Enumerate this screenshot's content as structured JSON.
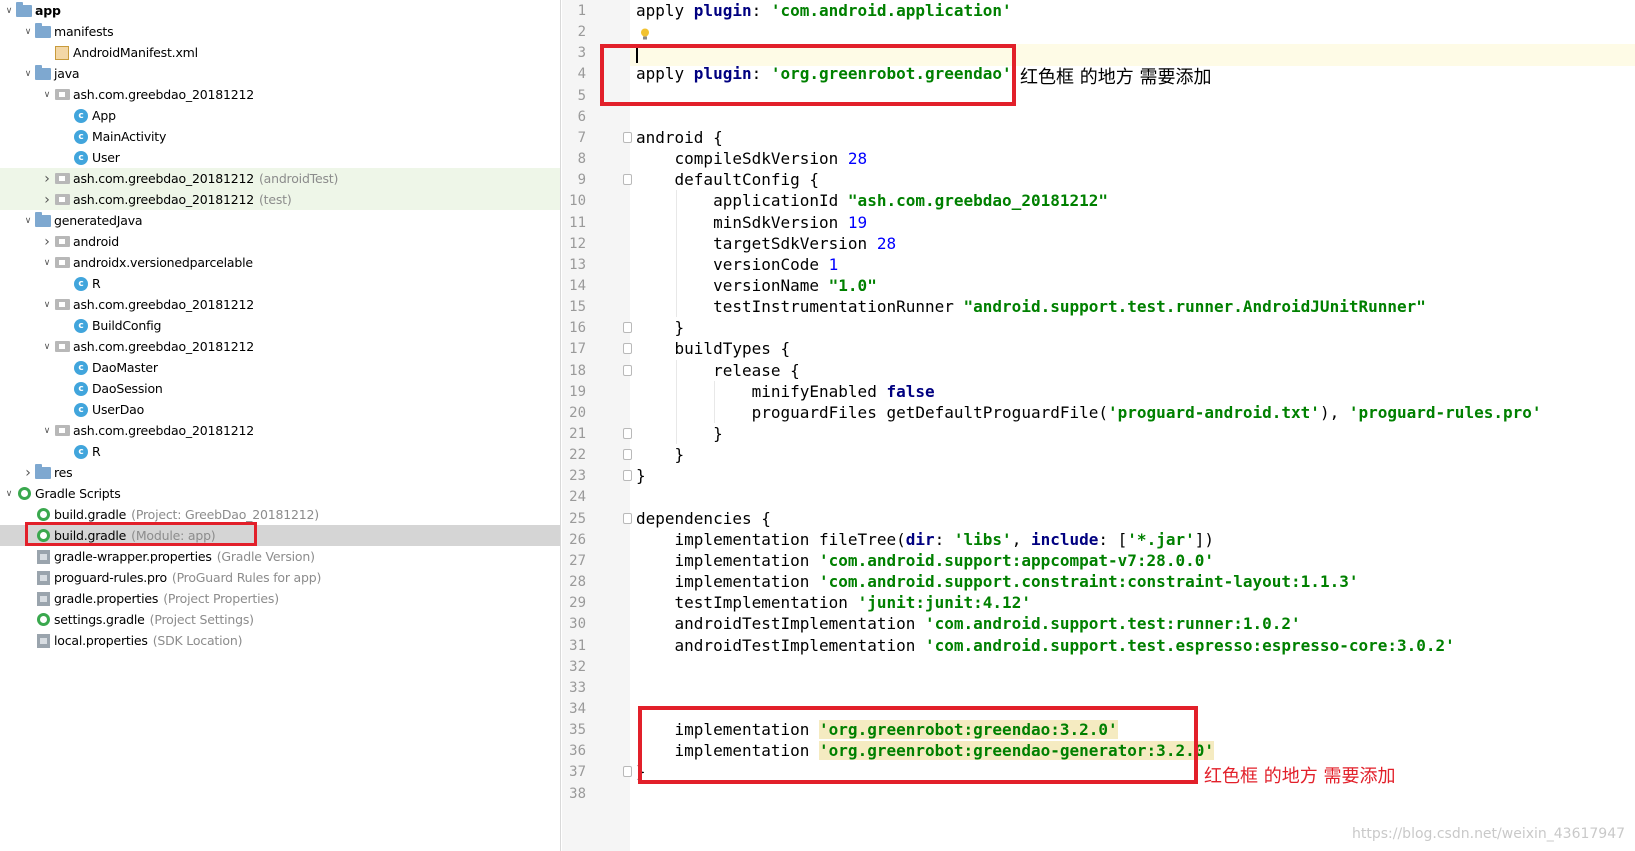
{
  "tree": {
    "rows": [
      {
        "indent": 0,
        "arrow": "down",
        "icon": "folder-icon",
        "label": "app",
        "suffix": "",
        "hl": ""
      },
      {
        "indent": 1,
        "arrow": "down",
        "icon": "folder-icon",
        "label": "manifests",
        "suffix": "",
        "hl": ""
      },
      {
        "indent": 2,
        "arrow": "",
        "icon": "xml-file-icon",
        "label": "AndroidManifest.xml",
        "suffix": "",
        "hl": ""
      },
      {
        "indent": 1,
        "arrow": "down",
        "icon": "folder-icon",
        "label": "java",
        "suffix": "",
        "hl": ""
      },
      {
        "indent": 2,
        "arrow": "down",
        "icon": "package-icon",
        "label": "ash.com.greebdao_20181212",
        "suffix": "",
        "hl": ""
      },
      {
        "indent": 3,
        "arrow": "",
        "icon": "class-icon",
        "label": "App",
        "suffix": "",
        "hl": ""
      },
      {
        "indent": 3,
        "arrow": "",
        "icon": "class-icon",
        "label": "MainActivity",
        "suffix": "",
        "hl": ""
      },
      {
        "indent": 3,
        "arrow": "",
        "icon": "class-icon",
        "label": "User",
        "suffix": "",
        "hl": ""
      },
      {
        "indent": 2,
        "arrow": "right",
        "icon": "package-icon",
        "label": "ash.com.greebdao_20181212",
        "suffix": "(androidTest)",
        "hl": "green"
      },
      {
        "indent": 2,
        "arrow": "right",
        "icon": "package-icon",
        "label": "ash.com.greebdao_20181212",
        "suffix": "(test)",
        "hl": "green"
      },
      {
        "indent": 1,
        "arrow": "down",
        "icon": "folder-icon",
        "label": "generatedJava",
        "suffix": "",
        "hl": ""
      },
      {
        "indent": 2,
        "arrow": "right",
        "icon": "package-icon",
        "label": "android",
        "suffix": "",
        "hl": ""
      },
      {
        "indent": 2,
        "arrow": "down",
        "icon": "package-icon",
        "label": "androidx.versionedparcelable",
        "suffix": "",
        "hl": ""
      },
      {
        "indent": 3,
        "arrow": "",
        "icon": "class-icon",
        "label": "R",
        "suffix": "",
        "hl": ""
      },
      {
        "indent": 2,
        "arrow": "down",
        "icon": "package-icon",
        "label": "ash.com.greebdao_20181212",
        "suffix": "",
        "hl": ""
      },
      {
        "indent": 3,
        "arrow": "",
        "icon": "class-icon",
        "label": "BuildConfig",
        "suffix": "",
        "hl": ""
      },
      {
        "indent": 2,
        "arrow": "down",
        "icon": "package-icon",
        "label": "ash.com.greebdao_20181212",
        "suffix": "",
        "hl": ""
      },
      {
        "indent": 3,
        "arrow": "",
        "icon": "class-icon",
        "label": "DaoMaster",
        "suffix": "",
        "hl": ""
      },
      {
        "indent": 3,
        "arrow": "",
        "icon": "class-icon",
        "label": "DaoSession",
        "suffix": "",
        "hl": ""
      },
      {
        "indent": 3,
        "arrow": "",
        "icon": "class-icon",
        "label": "UserDao",
        "suffix": "",
        "hl": ""
      },
      {
        "indent": 2,
        "arrow": "down",
        "icon": "package-icon",
        "label": "ash.com.greebdao_20181212",
        "suffix": "",
        "hl": ""
      },
      {
        "indent": 3,
        "arrow": "",
        "icon": "class-icon",
        "label": "R",
        "suffix": "",
        "hl": ""
      },
      {
        "indent": 1,
        "arrow": "right",
        "icon": "folder-icon",
        "label": "res",
        "suffix": "",
        "hl": ""
      },
      {
        "indent": 0,
        "arrow": "down",
        "icon": "gradle-icon",
        "label": "Gradle Scripts",
        "suffix": "",
        "hl": ""
      },
      {
        "indent": 1,
        "arrow": "",
        "icon": "gradle-icon",
        "label": "build.gradle",
        "suffix": "(Project: GreebDao_20181212)",
        "hl": ""
      },
      {
        "indent": 1,
        "arrow": "",
        "icon": "gradle-icon",
        "label": "build.gradle",
        "suffix": "(Module: app)",
        "hl": "grey"
      },
      {
        "indent": 1,
        "arrow": "",
        "icon": "properties-icon",
        "label": "gradle-wrapper.properties",
        "suffix": "(Gradle Version)",
        "hl": ""
      },
      {
        "indent": 1,
        "arrow": "",
        "icon": "properties-icon",
        "label": "proguard-rules.pro",
        "suffix": "(ProGuard Rules for app)",
        "hl": ""
      },
      {
        "indent": 1,
        "arrow": "",
        "icon": "properties-icon",
        "label": "gradle.properties",
        "suffix": "(Project Properties)",
        "hl": ""
      },
      {
        "indent": 1,
        "arrow": "",
        "icon": "gradle-icon",
        "label": "settings.gradle",
        "suffix": "(Project Settings)",
        "hl": ""
      },
      {
        "indent": 1,
        "arrow": "",
        "icon": "properties-icon",
        "label": "local.properties",
        "suffix": "(SDK Location)",
        "hl": ""
      }
    ]
  },
  "editor": {
    "current_line": 3,
    "lines": [
      [
        [
          "t",
          "apply "
        ],
        [
          "kw",
          "plugin"
        ],
        [
          "t",
          ": "
        ],
        [
          "str",
          "'com.android.application'"
        ]
      ],
      [
        [
          "t",
          ""
        ]
      ],
      [
        [
          "t",
          ""
        ]
      ],
      [
        [
          "t",
          "apply "
        ],
        [
          "kw",
          "plugin"
        ],
        [
          "t",
          ": "
        ],
        [
          "str",
          "'org.greenrobot.greendao'"
        ]
      ],
      [
        [
          "t",
          ""
        ]
      ],
      [
        [
          "t",
          ""
        ]
      ],
      [
        [
          "t",
          "android {"
        ]
      ],
      [
        [
          "t",
          "    compileSdkVersion "
        ],
        [
          "num",
          "28"
        ]
      ],
      [
        [
          "t",
          "    defaultConfig {"
        ]
      ],
      [
        [
          "t",
          "        applicationId "
        ],
        [
          "str",
          "\"ash.com.greebdao_20181212\""
        ]
      ],
      [
        [
          "t",
          "        minSdkVersion "
        ],
        [
          "num",
          "19"
        ]
      ],
      [
        [
          "t",
          "        targetSdkVersion "
        ],
        [
          "num",
          "28"
        ]
      ],
      [
        [
          "t",
          "        versionCode "
        ],
        [
          "num",
          "1"
        ]
      ],
      [
        [
          "t",
          "        versionName "
        ],
        [
          "str",
          "\"1.0\""
        ]
      ],
      [
        [
          "t",
          "        testInstrumentationRunner "
        ],
        [
          "str",
          "\"android.support.test.runner.AndroidJUnitRunner\""
        ]
      ],
      [
        [
          "t",
          "    }"
        ]
      ],
      [
        [
          "t",
          "    buildTypes {"
        ]
      ],
      [
        [
          "t",
          "        release {"
        ]
      ],
      [
        [
          "t",
          "            minifyEnabled "
        ],
        [
          "kw",
          "false"
        ]
      ],
      [
        [
          "t",
          "            proguardFiles getDefaultProguardFile("
        ],
        [
          "str",
          "'proguard-android.txt'"
        ],
        [
          "t",
          "), "
        ],
        [
          "str",
          "'proguard-rules.pro'"
        ]
      ],
      [
        [
          "t",
          "        }"
        ]
      ],
      [
        [
          "t",
          "    }"
        ]
      ],
      [
        [
          "t",
          "}"
        ]
      ],
      [
        [
          "t",
          ""
        ]
      ],
      [
        [
          "t",
          "dependencies {"
        ]
      ],
      [
        [
          "t",
          "    implementation fileTree("
        ],
        [
          "kw",
          "dir"
        ],
        [
          "t",
          ": "
        ],
        [
          "str",
          "'libs'"
        ],
        [
          "t",
          ", "
        ],
        [
          "kw",
          "include"
        ],
        [
          "t",
          ": ["
        ],
        [
          "str",
          "'*.jar'"
        ],
        [
          "t",
          "])"
        ]
      ],
      [
        [
          "t",
          "    implementation "
        ],
        [
          "str",
          "'com.android.support:appcompat-v7:28.0.0'"
        ]
      ],
      [
        [
          "t",
          "    implementation "
        ],
        [
          "str",
          "'com.android.support.constraint:constraint-layout:1.1.3'"
        ]
      ],
      [
        [
          "t",
          "    testImplementation "
        ],
        [
          "str",
          "'junit:junit:4.12'"
        ]
      ],
      [
        [
          "t",
          "    androidTestImplementation "
        ],
        [
          "str",
          "'com.android.support.test:runner:1.0.2'"
        ]
      ],
      [
        [
          "t",
          "    androidTestImplementation "
        ],
        [
          "str",
          "'com.android.support.test.espresso:espresso-core:3.0.2'"
        ]
      ],
      [
        [
          "t",
          ""
        ]
      ],
      [
        [
          "t",
          ""
        ]
      ],
      [
        [
          "t",
          ""
        ]
      ],
      [
        [
          "t",
          "    implementation "
        ],
        [
          "str-hl",
          "'org.greenrobot:greendao:3.2.0'"
        ]
      ],
      [
        [
          "t",
          "    implementation "
        ],
        [
          "str-hl",
          "'org.greenrobot:greendao-generator:3.2.0'"
        ]
      ],
      [
        [
          "t",
          "}"
        ]
      ],
      [
        [
          "t",
          ""
        ]
      ]
    ],
    "folds": [
      7,
      9,
      16,
      17,
      18,
      21,
      22,
      23,
      25,
      37
    ]
  },
  "annotations": {
    "top_note": "红色框 的地方 需要添加",
    "bottom_note": "红色框 的地方 需要添加"
  },
  "watermark": "https://blog.csdn.net/weixin_43617947",
  "colors": {
    "annotation_red": "#e2202a",
    "string_green": "#008000",
    "keyword_navy": "#000080",
    "number_blue": "#0000ff",
    "class_icon_blue": "#41a5dc",
    "gradle_icon_green": "#3aa84e"
  }
}
